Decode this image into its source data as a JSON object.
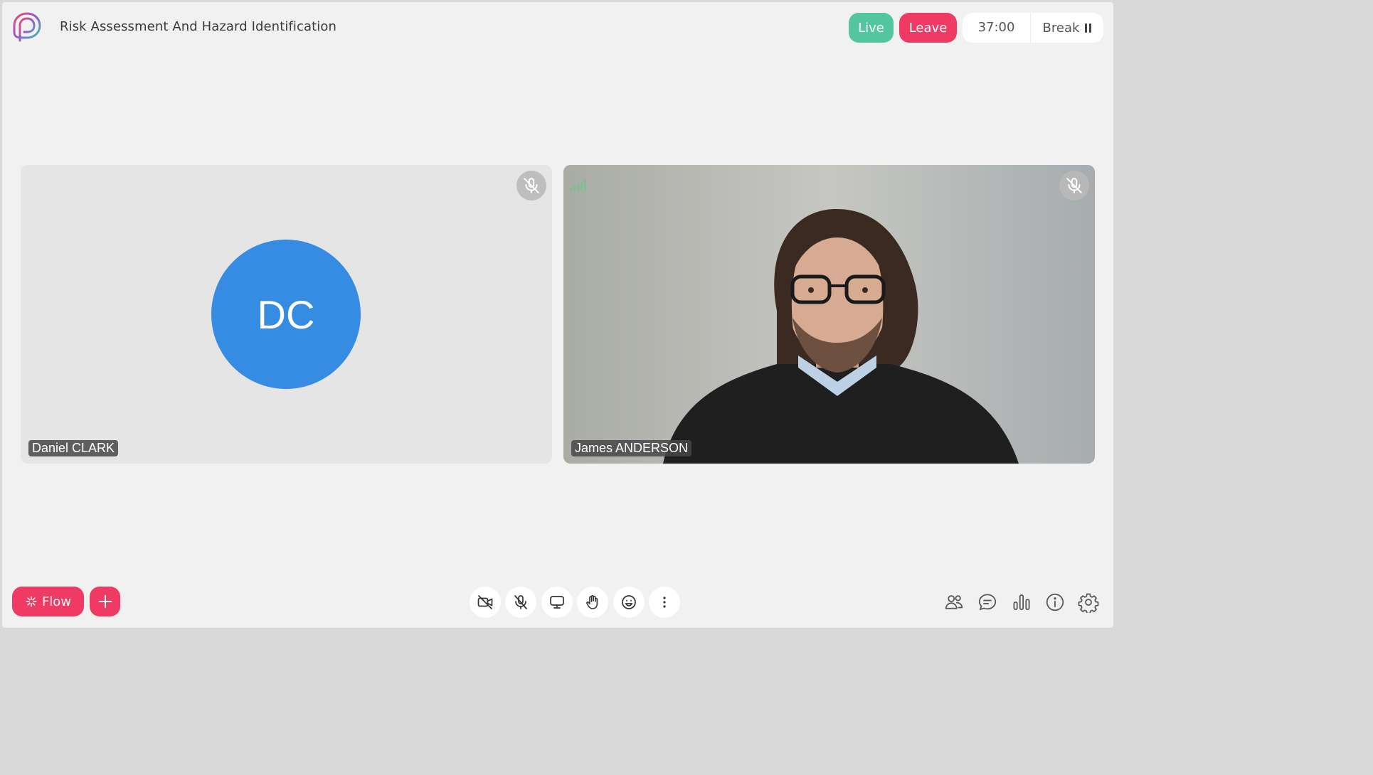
{
  "header": {
    "title": "Risk Assessment And Hazard Identification",
    "live_label": "Live",
    "leave_label": "Leave",
    "timer": "37:00",
    "break_label": "Break"
  },
  "participants": [
    {
      "name": "Daniel CLARK",
      "initials": "DC",
      "muted": true,
      "video": false
    },
    {
      "name": "James ANDERSON",
      "muted": true,
      "video": true
    }
  ],
  "toolbar": {
    "flow_label": "Flow",
    "center_icons": [
      "camera-off-icon",
      "mic-off-icon",
      "screen-share-icon",
      "raise-hand-icon",
      "emoji-icon",
      "more-icon"
    ],
    "right_icons": [
      "participants-icon",
      "chat-icon",
      "stats-icon",
      "info-icon",
      "settings-icon"
    ]
  },
  "colors": {
    "accent": "#ef3b63",
    "live": "#53c6a0",
    "avatar": "#368ce3",
    "background": "#f1f1f1"
  }
}
